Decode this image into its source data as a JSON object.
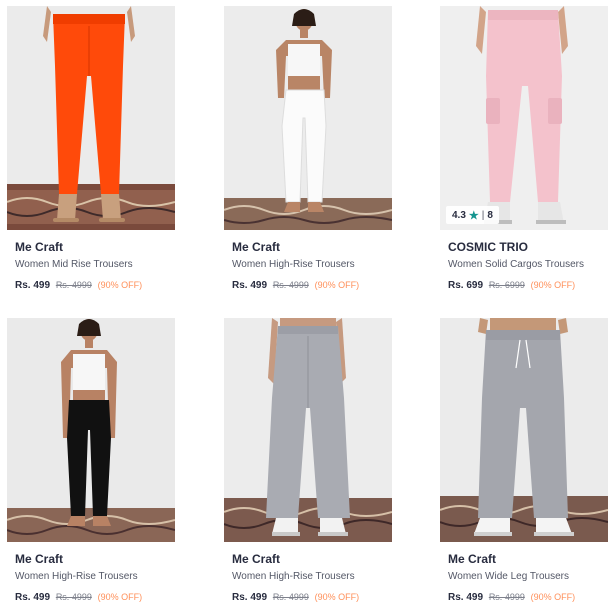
{
  "colors": {
    "brand_text": "#282c3f",
    "name_text": "#535766",
    "mrp_text": "#7e818c",
    "discount_text": "#ff905a",
    "rating_star": "#14958f"
  },
  "products": [
    {
      "brand": "Me Craft",
      "name": "Women Mid Rise Trousers",
      "price": "Rs. 499",
      "mrp": "Rs. 4999",
      "discount": "(90% OFF)",
      "image": "orange-trousers-on-rug"
    },
    {
      "brand": "Me Craft",
      "name": "Women High-Rise Trousers",
      "price": "Rs. 499",
      "mrp": "Rs. 4999",
      "discount": "(90% OFF)",
      "image": "white-trousers-on-rug"
    },
    {
      "brand": "COSMIC TRIO",
      "name": "Women Solid Cargos Trousers",
      "price": "Rs. 699",
      "mrp": "Rs. 6999",
      "discount": "(90% OFF)",
      "image": "pink-cargo-trousers",
      "rating": {
        "value": "4.3",
        "icon": "star-icon",
        "count": "8"
      }
    },
    {
      "brand": "Me Craft",
      "name": "Women High-Rise Trousers",
      "price": "Rs. 499",
      "mrp": "Rs. 4999",
      "discount": "(90% OFF)",
      "image": "black-trousers-on-rug"
    },
    {
      "brand": "Me Craft",
      "name": "Women High-Rise Trousers",
      "price": "Rs. 499",
      "mrp": "Rs. 4999",
      "discount": "(90% OFF)",
      "image": "grey-wide-trousers-on-rug"
    },
    {
      "brand": "Me Craft",
      "name": "Women Wide Leg Trousers",
      "price": "Rs. 499",
      "mrp": "Rs. 4999",
      "discount": "(90% OFF)",
      "image": "grey-drawstring-trousers-on-rug"
    }
  ]
}
